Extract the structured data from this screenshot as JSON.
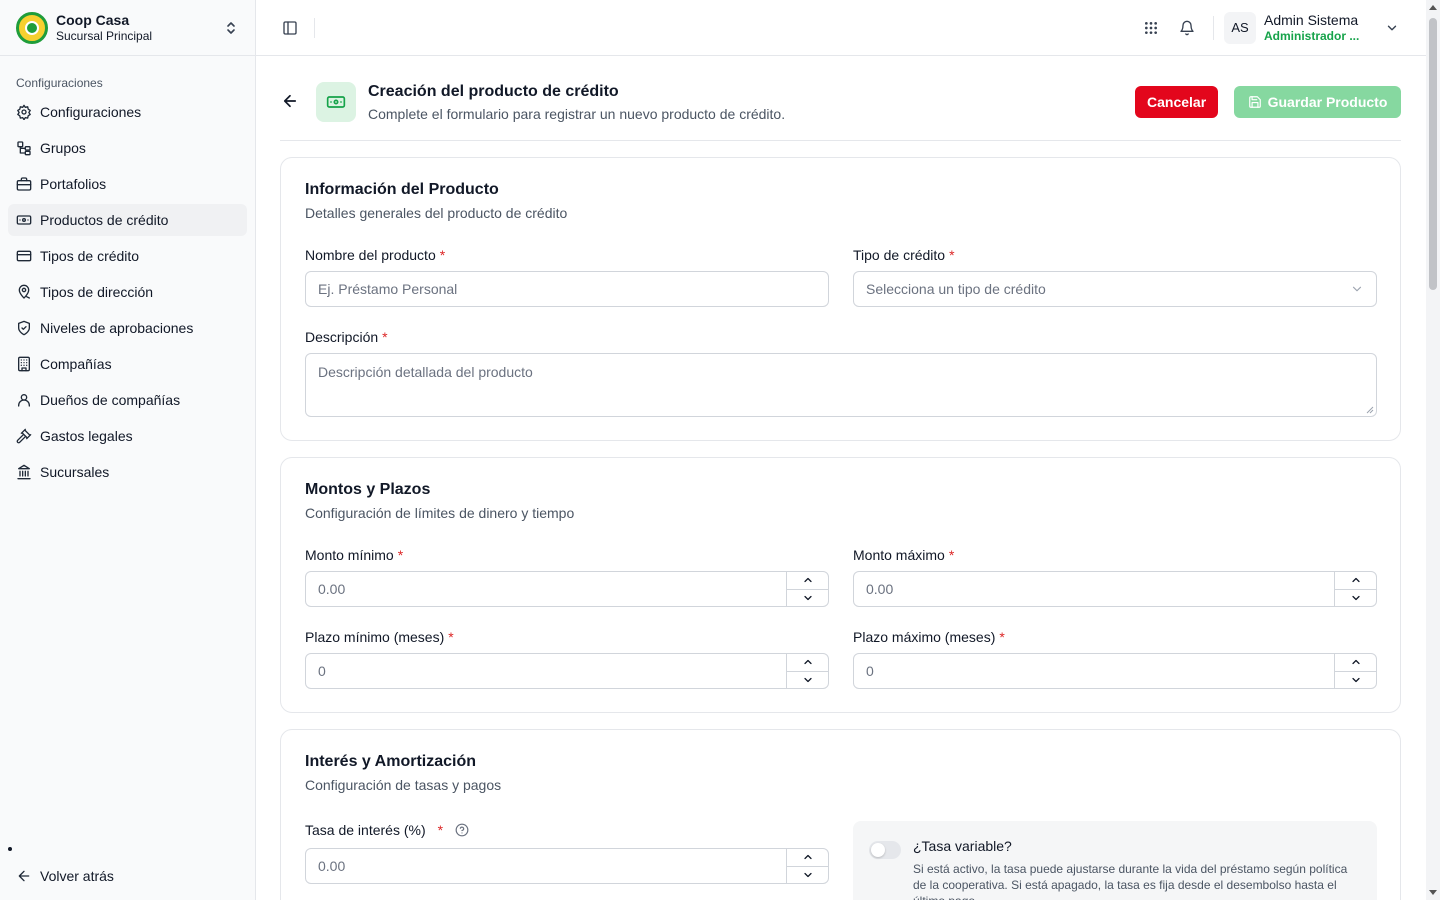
{
  "brand": {
    "name": "Coop Casa",
    "branch": "Sucursal Principal"
  },
  "sidebar": {
    "section_label": "Configuraciones",
    "items": [
      {
        "label": "Configuraciones",
        "icon": "gear-icon"
      },
      {
        "label": "Grupos",
        "icon": "network-icon"
      },
      {
        "label": "Portafolios",
        "icon": "briefcase-icon"
      },
      {
        "label": "Productos de crédito",
        "icon": "banknote-icon",
        "active": true
      },
      {
        "label": "Tipos de crédito",
        "icon": "credit-card-icon"
      },
      {
        "label": "Tipos de dirección",
        "icon": "map-pin-icon"
      },
      {
        "label": "Niveles de aprobaciones",
        "icon": "shield-check-icon"
      },
      {
        "label": "Compañías",
        "icon": "building-icon"
      },
      {
        "label": "Dueños de compañías",
        "icon": "user-icon"
      },
      {
        "label": "Gastos legales",
        "icon": "gavel-icon"
      },
      {
        "label": "Sucursales",
        "icon": "bank-icon"
      }
    ],
    "back_label": "Volver atrás"
  },
  "header": {
    "avatar_initials": "AS",
    "user_name": "Admin Sistema",
    "user_role": "Administrador ..."
  },
  "page": {
    "title": "Creación del producto de crédito",
    "subtitle": "Complete el formulario para registrar un nuevo producto de crédito.",
    "cancel_label": "Cancelar",
    "save_label": "Guardar Producto"
  },
  "product_info": {
    "title": "Información del Producto",
    "subtitle": "Detalles generales del producto de crédito",
    "name_label": "Nombre del producto",
    "name_placeholder": "Ej. Préstamo Personal",
    "type_label": "Tipo de crédito",
    "type_placeholder": "Selecciona un tipo de crédito",
    "description_label": "Descripción",
    "description_placeholder": "Descripción detallada del producto"
  },
  "amounts": {
    "title": "Montos y Plazos",
    "subtitle": "Configuración de límites de dinero y tiempo",
    "min_amount_label": "Monto mínimo",
    "min_amount_value": "0.00",
    "max_amount_label": "Monto máximo",
    "max_amount_value": "0.00",
    "min_term_label": "Plazo mínimo (meses)",
    "min_term_value": "0",
    "max_term_label": "Plazo máximo (meses)",
    "max_term_value": "0"
  },
  "interest": {
    "title": "Interés y Amortización",
    "subtitle": "Configuración de tasas y pagos",
    "rate_label": "Tasa de interés (%)",
    "rate_value": "0.00",
    "variable_title": "¿Tasa variable?",
    "variable_text": "Si está activo, la tasa puede ajustarse durante la vida del préstamo según política de la cooperativa. Si está apagado, la tasa es fija desde el desembolso hasta el último pago.",
    "variable_enabled": false
  },
  "required_mark": "*",
  "colors": {
    "brand_green": "#16a34a",
    "danger": "#e3061c",
    "save_disabled": "#86d8a0"
  }
}
